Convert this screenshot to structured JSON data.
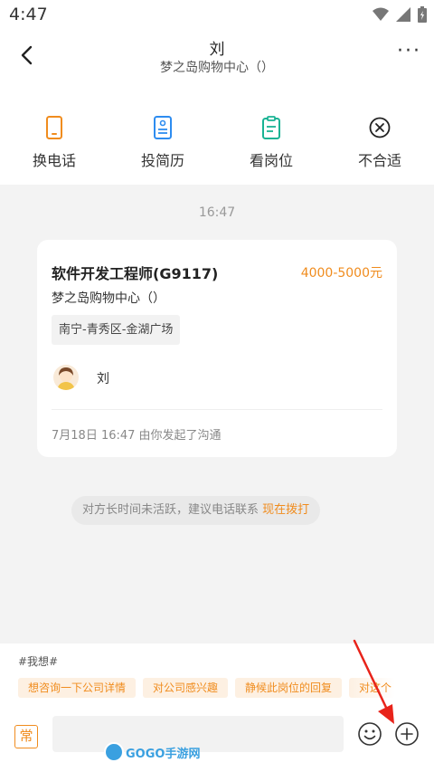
{
  "status_bar": {
    "time": "4:47",
    "icons": [
      "wifi-icon",
      "signal-icon",
      "battery-icon"
    ]
  },
  "header": {
    "title": "刘",
    "subtitle": "梦之岛购物中心（）"
  },
  "actions": [
    {
      "label": "换电话",
      "icon": "phone-icon"
    },
    {
      "label": "投简历",
      "icon": "resume-icon"
    },
    {
      "label": "看岗位",
      "icon": "job-icon"
    },
    {
      "label": "不合适",
      "icon": "close-circle-icon"
    }
  ],
  "chat": {
    "time": "16:47",
    "card": {
      "job_title": "软件开发工程师(G9117)",
      "salary": "4000-5000元",
      "company": "梦之岛购物中心（）",
      "location": "南宁-青秀区-金湖广场",
      "recruiter": "刘",
      "footer": "7月18日 16:47 由你发起了沟通"
    },
    "notice": {
      "text": "对方长时间未活跃，建议电话联系",
      "action": "现在拨打"
    }
  },
  "bottom": {
    "hashtag": "#我想#",
    "chips": [
      "想咨询一下公司详情",
      "对公司感兴趣",
      "静候此岗位的回复",
      "对这个"
    ],
    "common_label": "常",
    "input_value": "",
    "input_placeholder": ""
  },
  "watermark": {
    "text": "GOGO手游网"
  },
  "colors": {
    "accent": "#f08c1e",
    "arrow": "#e8231a"
  }
}
